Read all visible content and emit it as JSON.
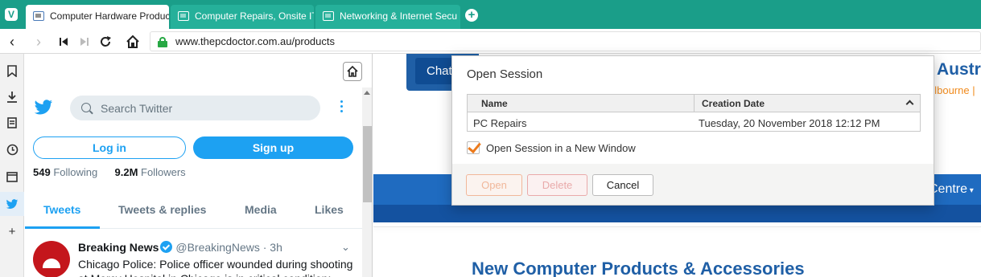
{
  "browser": {
    "tabs": [
      {
        "label": "Computer Hardware Products",
        "active": true
      },
      {
        "label": "Computer Repairs, Onsite IT",
        "active": false
      },
      {
        "label": "Networking & Internet Secu",
        "active": false
      }
    ],
    "url": "www.thepcdoctor.com.au/products",
    "accent_color": "#1a9e89",
    "side_panels": [
      "bookmark-icon",
      "download-icon",
      "notes-icon",
      "history-icon",
      "window-icon",
      "twitter-icon",
      "add-panel-icon"
    ]
  },
  "twitter": {
    "search_placeholder": "Search Twitter",
    "login_label": "Log in",
    "signup_label": "Sign up",
    "following_count": "549",
    "following_label": "Following",
    "followers_count": "9.2M",
    "followers_label": "Followers",
    "tabs": [
      "Tweets",
      "Tweets & replies",
      "Media",
      "Likes"
    ],
    "tweet": {
      "author": "Breaking News",
      "handle": "@BreakingNews",
      "time": "· 3h",
      "text": "Chicago Police: Police officer wounded during shooting at Mercy Hospital in Chicago is in critical condition;"
    },
    "brand_color": "#1da1f2"
  },
  "website": {
    "chat_label": "Chat",
    "title_fragment": "Austra",
    "subtitle_fragment": "elbourne |",
    "nav_fragment": "Centre",
    "heading": "New Computer Products & Accessories"
  },
  "dialog": {
    "title": "Open Session",
    "columns": [
      "Name",
      "Creation Date"
    ],
    "rows": [
      {
        "name": "PC Repairs",
        "date": "Tuesday, 20 November 2018 12:12 PM"
      }
    ],
    "checkbox_label": "Open Session in a New Window",
    "checkbox_checked": true,
    "open_label": "Open",
    "delete_label": "Delete",
    "cancel_label": "Cancel"
  }
}
